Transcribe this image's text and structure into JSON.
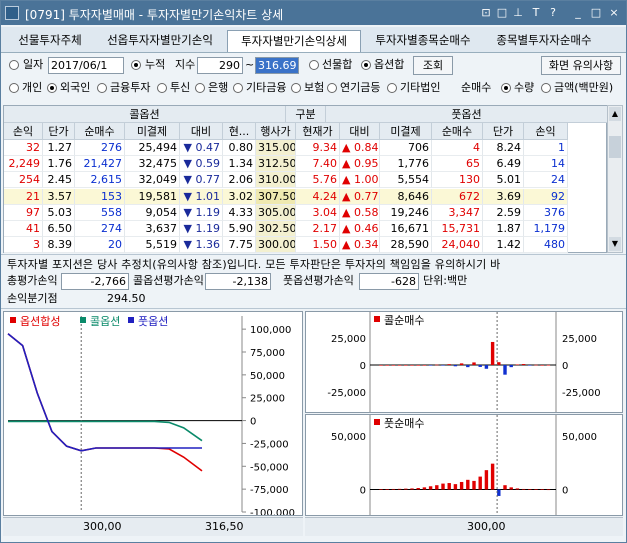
{
  "window": {
    "title": "[0791] 투자자별매매 - 투자자별만기손익차트 상세",
    "buttons": [
      "⊡",
      "□",
      "⊥",
      "T",
      "?",
      "_",
      "□",
      "×"
    ]
  },
  "tabs": [
    {
      "label": "선물투자주체",
      "active": false
    },
    {
      "label": "선옵투자자별만기손익",
      "active": false
    },
    {
      "label": "투자자별만기손익상세",
      "active": true
    },
    {
      "label": "투자자별종목순매수",
      "active": false
    },
    {
      "label": "종목별투자자순매수",
      "active": false
    }
  ],
  "controls": {
    "day_label": "일자",
    "date_value": "2017/06/1",
    "cumulative_label": "누적",
    "index_label": "지수",
    "index_from": "290",
    "index_sep": "~",
    "index_to": "316.69",
    "futures_combined_label": "선물합",
    "options_combined_label": "옵션합",
    "query_button": "조회",
    "screen_notice_button": "화면 유의사항",
    "investors": [
      "개인",
      "외국인",
      "금융투자",
      "투신",
      "은행",
      "기타금융",
      "보험",
      "연기금등",
      "기타법인"
    ],
    "selected_investor": "외국인",
    "net_buy_label": "순매수",
    "quantity_label": "수량",
    "amount_label": "금액(백만원)"
  },
  "grid": {
    "call_header": "콜옵션",
    "gubun_header": "구분",
    "put_header": "풋옵션",
    "columns": [
      "손익",
      "단가",
      "순매수",
      "미결제",
      "대비",
      "현...",
      "행사가",
      "현재가",
      "대비",
      "미결제",
      "순매수",
      "단가",
      "손익"
    ],
    "rows": [
      [
        "32",
        "1.27",
        "276",
        "25,494",
        "▼ 0.47",
        "0.80",
        "315.00",
        "9.34",
        "▲ 0.84",
        "706",
        "4",
        "8.24",
        "1"
      ],
      [
        "2,249",
        "1.76",
        "21,427",
        "32,475",
        "▼ 0.59",
        "1.34",
        "312.50",
        "7.40",
        "▲ 0.95",
        "1,776",
        "65",
        "6.49",
        "14"
      ],
      [
        "254",
        "2.45",
        "2,615",
        "32,049",
        "▼ 0.77",
        "2.06",
        "310.00",
        "5.76",
        "▲ 1.00",
        "5,554",
        "130",
        "5.01",
        "24"
      ],
      [
        "21",
        "3.57",
        "153",
        "19,581",
        "▼ 1.01",
        "3.02",
        "307.50",
        "4.24",
        "▲ 0.77",
        "8,646",
        "672",
        "3.69",
        "92"
      ],
      [
        "97",
        "5.03",
        "558",
        "9,054",
        "▼ 1.19",
        "4.33",
        "305.00",
        "3.04",
        "▲ 0.58",
        "19,246",
        "3,347",
        "2.59",
        "376"
      ],
      [
        "41",
        "6.50",
        "274",
        "3,637",
        "▼ 1.19",
        "5.90",
        "302.50",
        "2.17",
        "▲ 0.46",
        "16,671",
        "15,731",
        "1.87",
        "1,179"
      ],
      [
        "3",
        "8.39",
        "20",
        "5,519",
        "▼ 1.36",
        "7.75",
        "300.00",
        "1.50",
        "▲ 0.34",
        "28,590",
        "24,040",
        "1.42",
        "480"
      ]
    ]
  },
  "notice": {
    "text": "투자자별 포지션은 당사 추정치(유의사항 참조)입니다. 모든 투자판단은 투자자의 책임임을 유의하시기 바",
    "total_eval_label": "총평가손익",
    "total_eval_value": "-2,766",
    "call_eval_label": "콜옵션평가손익",
    "call_eval_value": "-2,138",
    "put_eval_label": "풋옵션평가손익",
    "put_eval_value": "-628",
    "unit_label": "단위:백만",
    "breakeven_label": "손익분기점",
    "breakeven_value": "294.50"
  },
  "chart_data": [
    {
      "type": "line",
      "legend": [
        "옵션합성",
        "콜옵션",
        "풋옵션"
      ],
      "colors": {
        "combined": "#e00000",
        "call": "#0a8a6a",
        "put": "#2020c0"
      },
      "x": [
        290,
        292,
        294,
        296,
        298,
        300,
        302,
        304,
        306,
        308,
        310,
        312,
        314,
        316.5
      ],
      "series": [
        {
          "name": "옵션합성",
          "values": [
            95000,
            82000,
            30000,
            -12000,
            -28000,
            -33000,
            -30000,
            -30000,
            -30000,
            -30000,
            -30000,
            -31000,
            -40000,
            -55000
          ]
        },
        {
          "name": "콜옵션",
          "values": [
            -1000,
            -1000,
            -1000,
            -1000,
            -1000,
            -1000,
            -1000,
            -1000,
            -1000,
            -1000,
            -1000,
            -2000,
            -8000,
            -22000
          ]
        },
        {
          "name": "풋옵션",
          "values": [
            95000,
            82000,
            30000,
            -12000,
            -28000,
            -33000,
            -30000,
            -30000,
            -30000,
            -30000,
            -30000,
            -30000,
            -30000,
            -30000
          ]
        }
      ],
      "yticks": [
        "100,000",
        "75,000",
        "50,000",
        "25,000",
        "0",
        "-25,000",
        "-50,000",
        "-75,000",
        "-100,000"
      ],
      "ylim": [
        -100000,
        110000
      ],
      "xticks": [
        "300,00",
        "316,50"
      ]
    },
    {
      "type": "bar",
      "title": "콜순매수",
      "yticks_left": [
        "25,000",
        "0",
        "-25,000"
      ],
      "yticks_right": [
        "25,000",
        "0",
        "-25,000"
      ],
      "ylim": [
        -40000,
        40000
      ],
      "values": [
        0,
        0,
        0,
        0,
        0,
        0,
        0,
        0,
        -200,
        300,
        -500,
        800,
        -1200,
        1500,
        -2000,
        2400,
        -1800,
        -3500,
        21427,
        2615,
        -9000,
        -2000,
        500,
        900,
        -300,
        200,
        0,
        100
      ]
    },
    {
      "type": "bar",
      "title": "풋순매수",
      "yticks_left": [
        "50,000",
        "0"
      ],
      "yticks_right": [
        "50,000",
        "0"
      ],
      "ylim": [
        -20000,
        60000
      ],
      "values": [
        200,
        300,
        500,
        600,
        800,
        1000,
        1400,
        2000,
        3000,
        4000,
        5500,
        6000,
        5000,
        7000,
        9000,
        8000,
        12000,
        18000,
        24040,
        -6000,
        4000,
        2000,
        1000,
        500,
        300,
        200,
        100,
        50
      ],
      "xticks": [
        "300,00"
      ]
    }
  ]
}
